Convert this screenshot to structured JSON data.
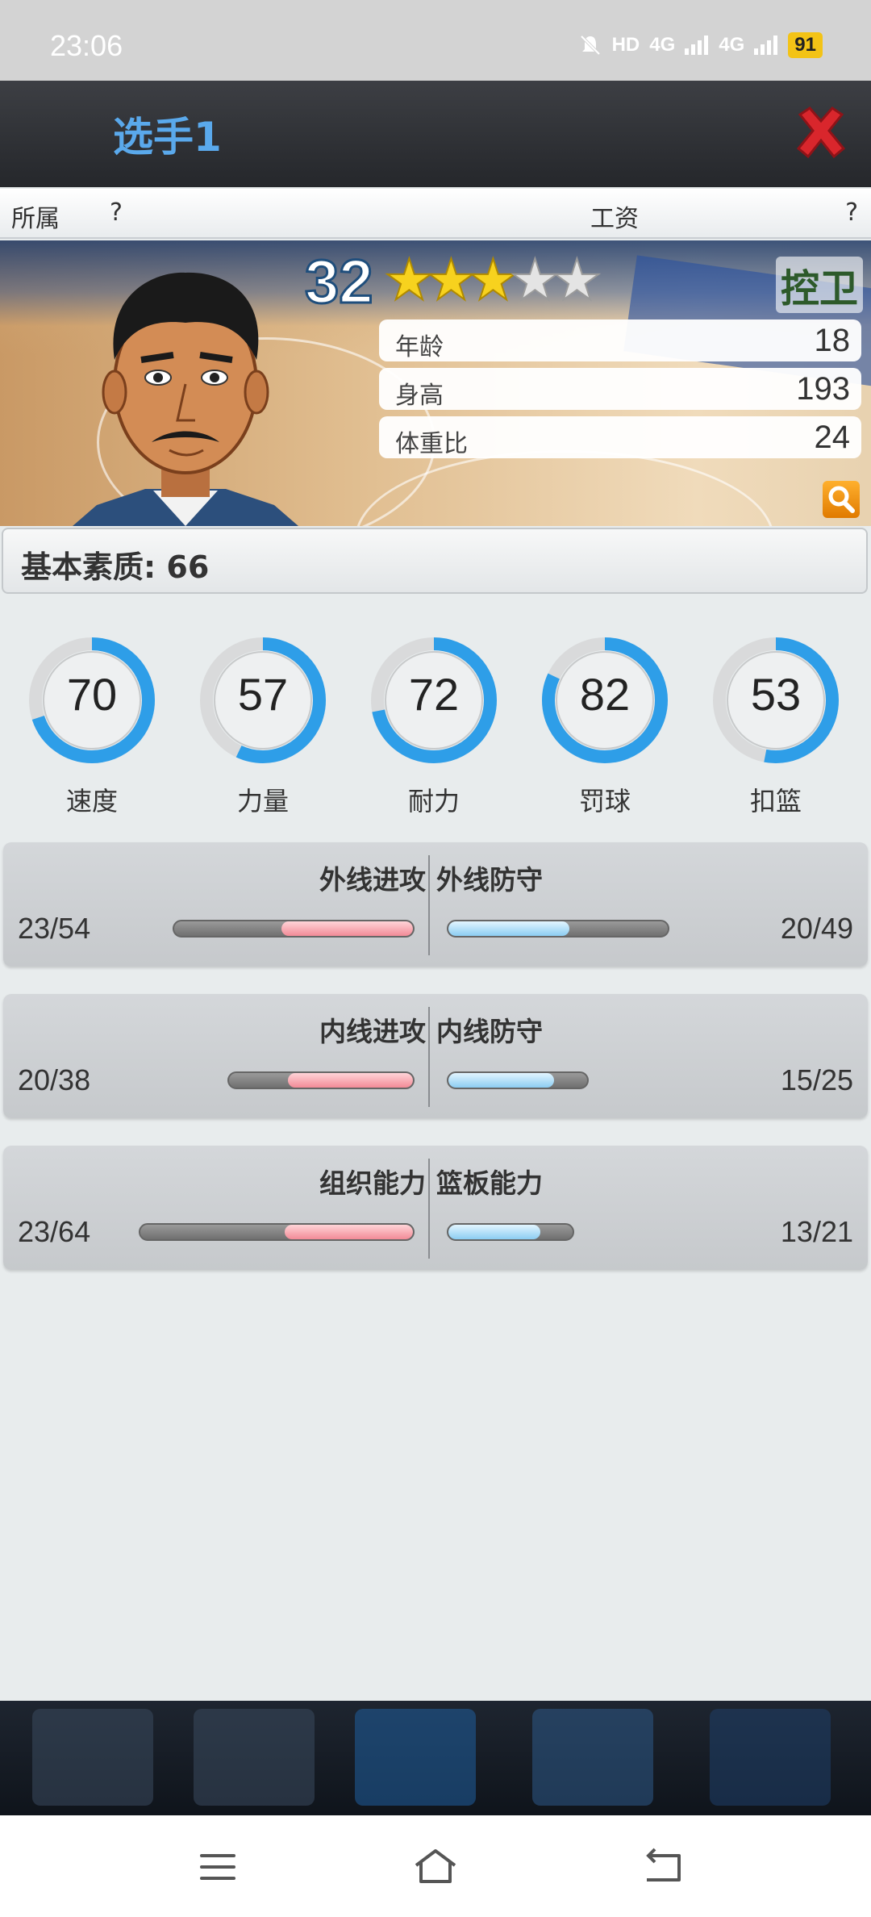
{
  "status_bar": {
    "time": "23:06",
    "icons": [
      "mute-icon",
      "hd-icon",
      "signal-4g-icon",
      "signal-4g-icon"
    ],
    "hd_label": "HD",
    "net1": "4G",
    "net2": "4G",
    "battery": "91"
  },
  "header": {
    "title": "选手1",
    "close_icon": "close-x-icon",
    "close_color": "#d9262c"
  },
  "info_row": {
    "affiliation_label": "所属",
    "affiliation_value": "?",
    "salary_label": "工资",
    "salary_value": "?"
  },
  "player": {
    "rating": "32",
    "stars_total": 5,
    "stars_filled": 3,
    "position": "控卫",
    "attributes": [
      {
        "label": "年龄",
        "value": "18"
      },
      {
        "label": "身高",
        "value": "193"
      },
      {
        "label": "体重比",
        "value": "24"
      }
    ]
  },
  "base_quality": {
    "text": "基本素质: 66"
  },
  "gauges": [
    {
      "label": "速度",
      "value": 70
    },
    {
      "label": "力量",
      "value": 57
    },
    {
      "label": "耐力",
      "value": 72
    },
    {
      "label": "罚球",
      "value": 82
    },
    {
      "label": "扣篮",
      "value": 53
    }
  ],
  "comparisons": [
    {
      "left_title": "外线进攻",
      "left_value": "23/54",
      "right_title": "外线防守",
      "right_value": "20/49"
    },
    {
      "left_title": "内线进攻",
      "left_value": "20/38",
      "right_title": "内线防守",
      "right_value": "15/25"
    },
    {
      "left_title": "组织能力",
      "left_value": "23/64",
      "right_title": "篮板能力",
      "right_value": "13/21"
    }
  ],
  "colors": {
    "gauge_blue": "#2e9ee8",
    "gauge_track": "#d9dadb",
    "attack_bar": "#f28b97",
    "defense_bar": "#8ccdf2",
    "title_blue": "#5aa9ec"
  }
}
